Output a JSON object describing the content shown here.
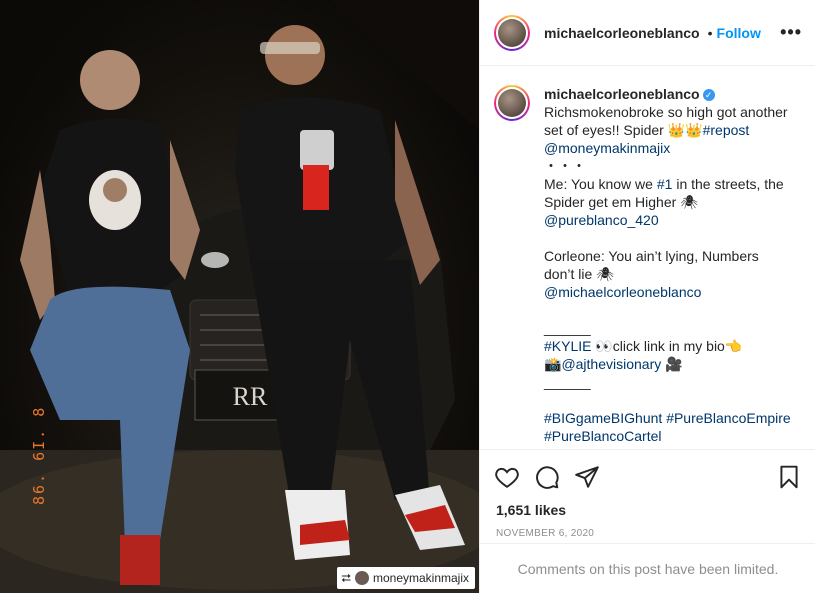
{
  "post": {
    "photo_date_stamp": "86. 6I. 8",
    "repost_credit": "moneymakinmajix"
  },
  "header": {
    "username": "michaelcorleoneblanco",
    "dot": "•",
    "follow_label": "Follow",
    "more_label": "•••"
  },
  "caption": {
    "username": "michaelcorleoneblanco",
    "verified": "✓",
    "lines": [
      "Richsmokenobroke so high got another",
      "set of eyes!! Spider 👑👑",
      "@moneymakinmajix",
      "・・・",
      "Me: You know we ",
      " in the streets, the",
      "Spider get em Higher 🕷",
      "@pureblanco_420",
      "Corleone: You ain’t lying, Numbers",
      "don’t lie 🕷",
      "@michaelcorleoneblanco",
      "______",
      "👀click link in my bio👈",
      "📸",
      " 🎥",
      "______"
    ],
    "tags": {
      "repost": "#repost",
      "one": "#1",
      "kylie": "#KYLIE",
      "ajthevisionary": "@ajthevisionary",
      "biggame": "#BIGgameBIGhunt",
      "pureblancoempire": "#PureBlancoEmpire",
      "pureblancocartel": "#PureBlancoCartel"
    }
  },
  "actions": {
    "like_icon": "heart-icon",
    "comment_icon": "comment-icon",
    "share_icon": "share-icon",
    "save_icon": "bookmark-icon",
    "likes": "1,651 likes",
    "date": "NOVEMBER 6, 2020"
  },
  "comments": {
    "limited_text": "Comments on this post have been limited."
  },
  "colors": {
    "link": "#00376b",
    "follow": "#0095f6",
    "muted": "#8e8e8e",
    "date_stamp": "#e8782a"
  }
}
